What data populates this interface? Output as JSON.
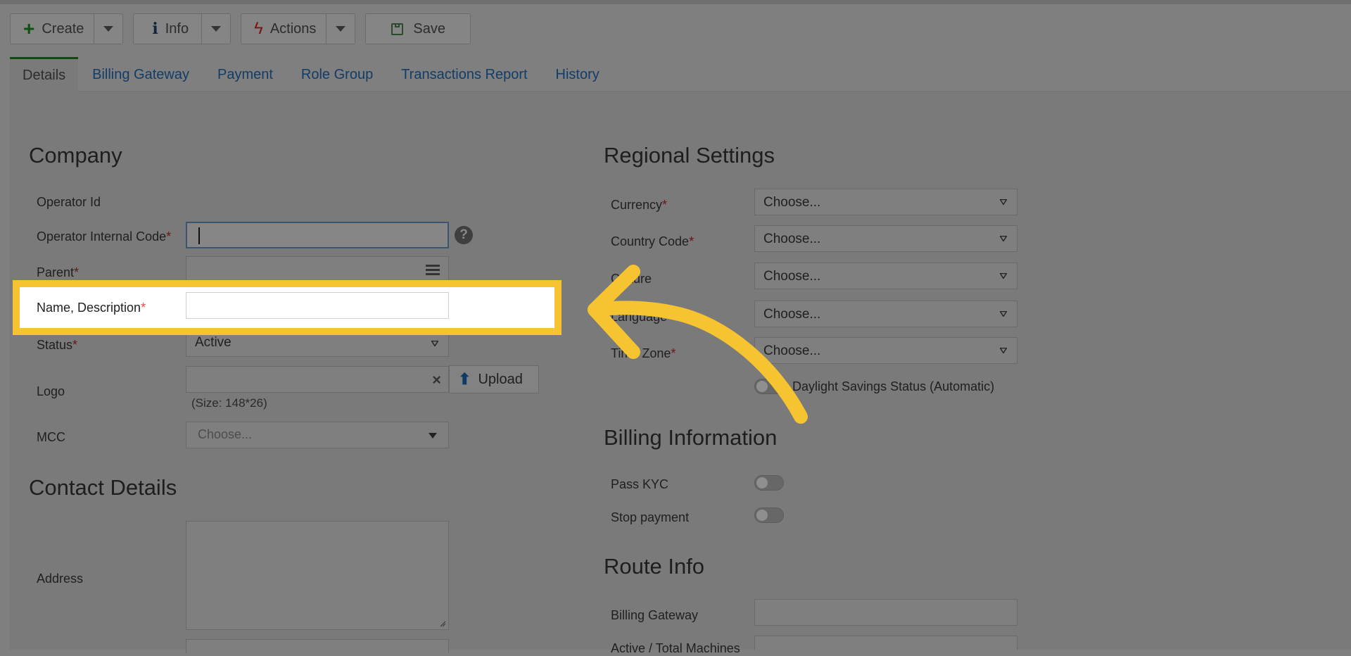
{
  "toolbar": {
    "create": "Create",
    "info": "Info",
    "actions": "Actions",
    "save": "Save"
  },
  "tabs": [
    "Details",
    "Billing Gateway",
    "Payment",
    "Role Group",
    "Transactions Report",
    "History"
  ],
  "company": {
    "heading": "Company",
    "operator_id": "Operator Id",
    "operator_internal_code": "Operator Internal Code",
    "parent": "Parent",
    "name_description": "Name, Description",
    "status": "Status",
    "status_value": "Active",
    "logo": "Logo",
    "upload": "Upload",
    "logo_size": "(Size: 148*26)",
    "mcc": "MCC",
    "mcc_placeholder": "Choose...",
    "required_mark": "*"
  },
  "contact": {
    "heading": "Contact Details",
    "address": "Address"
  },
  "regional": {
    "heading": "Regional Settings",
    "currency": "Currency",
    "country_code": "Country Code",
    "culture": "Culture",
    "language": "Language",
    "time_zone": "Time Zone",
    "choose": "Choose...",
    "daylight": "Daylight Savings Status (Automatic)"
  },
  "billing": {
    "heading": "Billing Information",
    "pass_kyc": "Pass KYC",
    "stop_payment": "Stop payment"
  },
  "route": {
    "heading": "Route Info",
    "billing_gateway": "Billing Gateway",
    "active_total_machines": "Active / Total Machines"
  },
  "colors": {
    "highlight": "#f5c430",
    "overlay": "#7f7f7f"
  }
}
